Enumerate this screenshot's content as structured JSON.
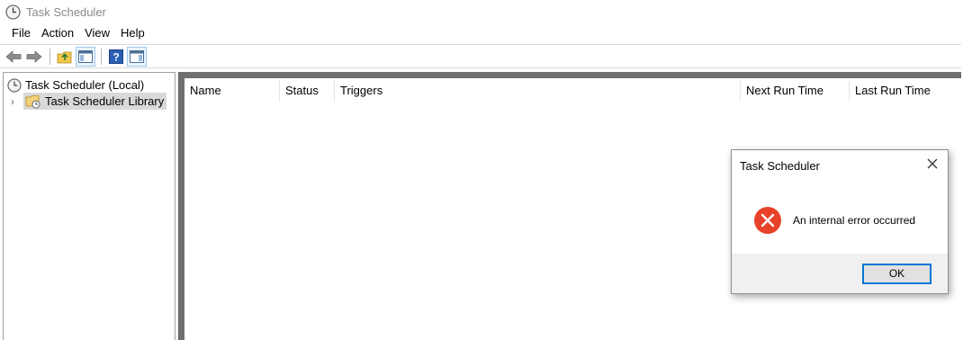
{
  "window": {
    "title": "Task Scheduler"
  },
  "menu": {
    "items": [
      "File",
      "Action",
      "View",
      "Help"
    ]
  },
  "toolbar": {
    "buttons": [
      "back-arrow-icon",
      "forward-arrow-icon",
      "up-folder-icon",
      "show-hide-console-tree-icon",
      "help-icon",
      "show-hide-action-pane-icon"
    ]
  },
  "tree": {
    "root": "Task Scheduler (Local)",
    "child": "Task Scheduler Library"
  },
  "list": {
    "columns": [
      "Name",
      "Status",
      "Triggers",
      "Next Run Time",
      "Last Run Time"
    ]
  },
  "dialog": {
    "title": "Task Scheduler",
    "message": "An internal error occurred",
    "ok_label": "OK",
    "icon": "error-icon"
  },
  "colors": {
    "error_red": "#e8422b",
    "focus_blue": "#0078d7",
    "pane_border": "#6f6f6f"
  }
}
